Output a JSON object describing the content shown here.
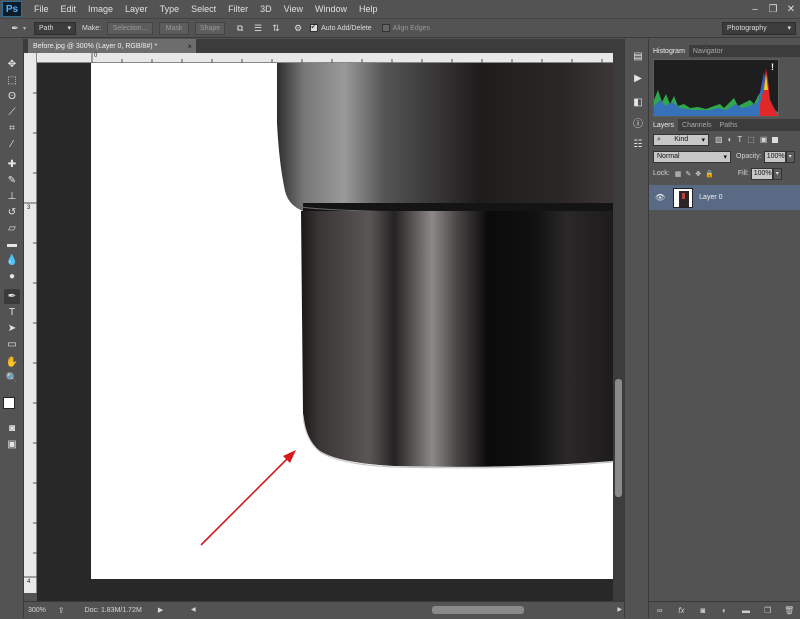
{
  "app": {
    "logo": "Ps"
  },
  "menu": [
    "File",
    "Edit",
    "Image",
    "Layer",
    "Type",
    "Select",
    "Filter",
    "3D",
    "View",
    "Window",
    "Help"
  ],
  "window_controls": [
    "–",
    "❐",
    "✕"
  ],
  "options": {
    "mode": "Path",
    "make_label": "Make:",
    "selection": "Selection...",
    "mask": "Mask",
    "shape": "Shape",
    "auto_add_delete": "Auto Add/Delete",
    "auto_add_delete_checked": true,
    "align_edges": "Align Edges",
    "align_edges_checked": false,
    "workspace": "Photography"
  },
  "document": {
    "tab_title": "Before.jpg @ 300% (Layer 0, RGB/8#) *",
    "close": "×"
  },
  "rulers": {
    "top": [
      "0"
    ],
    "left": [
      "3",
      "4"
    ]
  },
  "status": {
    "zoom": "300%",
    "doc_info": "Doc: 1.83M/1.72M"
  },
  "panels": {
    "top_tabs": [
      "Histogram",
      "Navigator"
    ],
    "layer_tabs": [
      "Layers",
      "Channels",
      "Paths"
    ],
    "kind": "Kind",
    "blend_mode": "Normal",
    "opacity_label": "Opacity:",
    "opacity_value": "100%",
    "lock_label": "Lock:",
    "fill_label": "Fill:",
    "fill_value": "100%",
    "layer_name": "Layer 0",
    "warning_icon": "!"
  },
  "colors": {
    "accent_selected_layer": "#596a84",
    "arrow": "#d41a1a"
  }
}
